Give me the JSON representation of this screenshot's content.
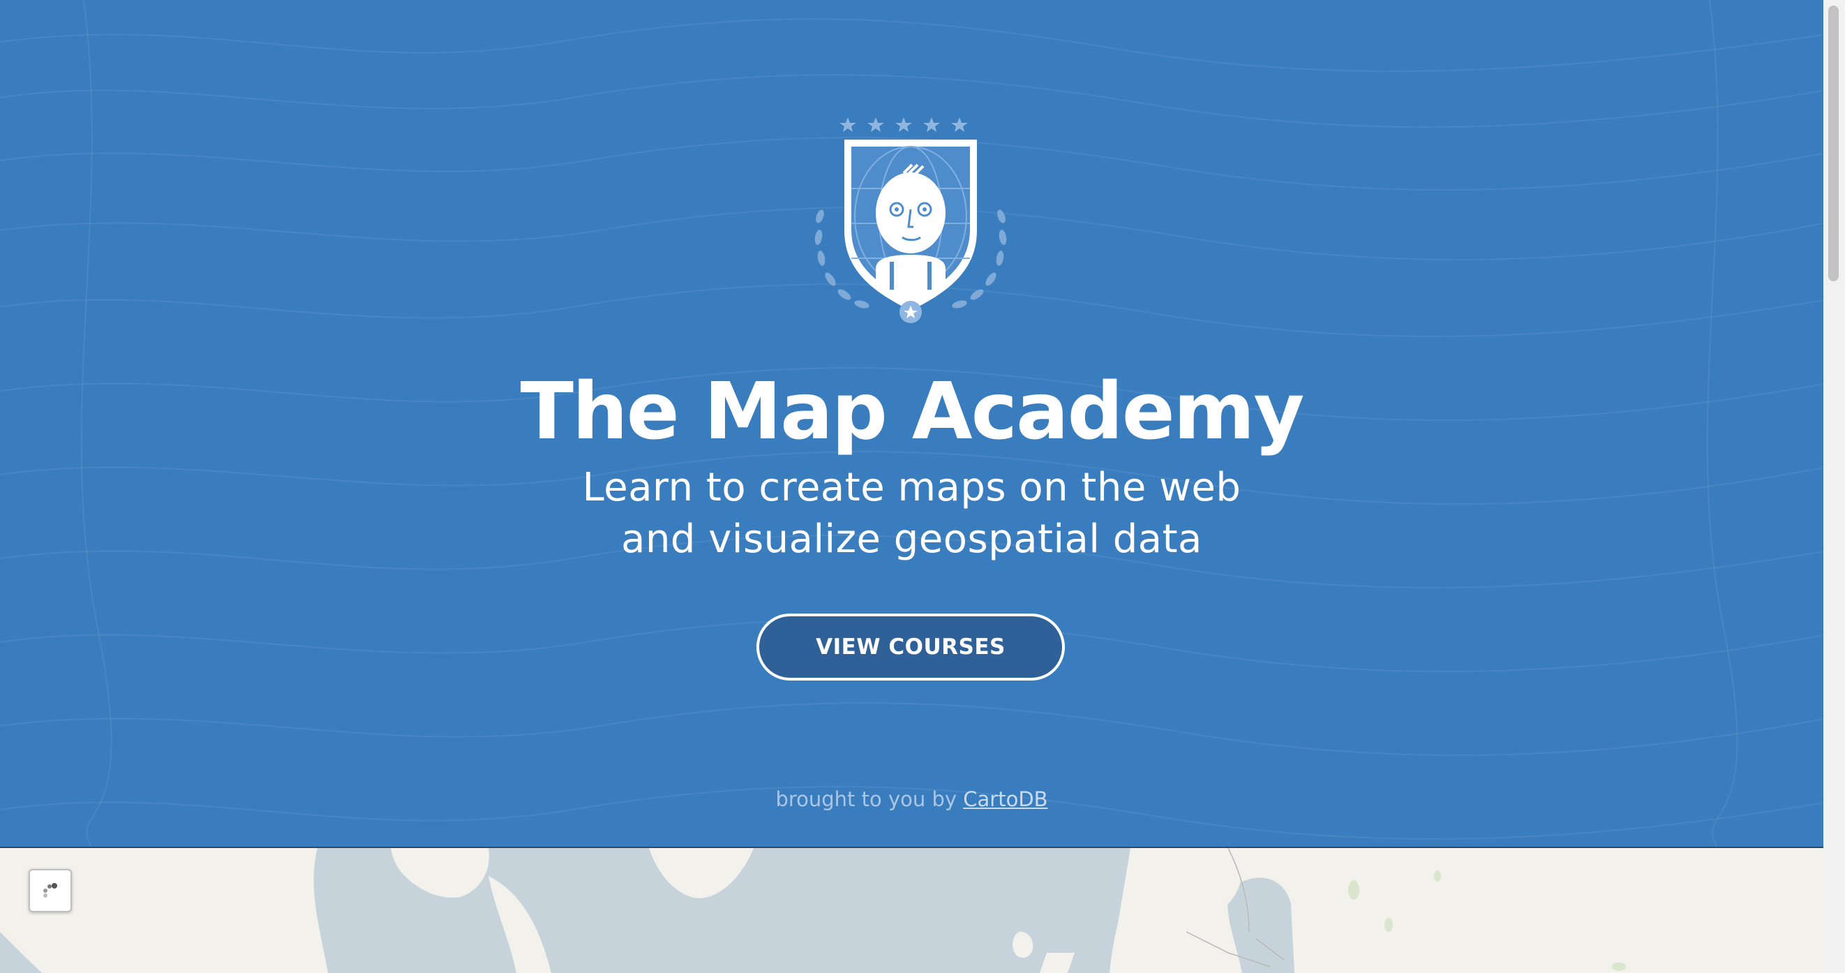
{
  "hero": {
    "background_color": "#3a7dbe",
    "badge_icon": "map-academy-crest",
    "title": "The Map Academy",
    "subtitle_line1": "Learn to create maps on the web",
    "subtitle_line2": "and visualize geospatial data",
    "cta_label": "VIEW COURSES",
    "credit_prefix": "brought to you by",
    "credit_link": "CartoDB"
  },
  "map": {
    "land_color": "#f2f1ec",
    "water_color": "#c7d3db",
    "layers_icon": "layers-icon"
  }
}
